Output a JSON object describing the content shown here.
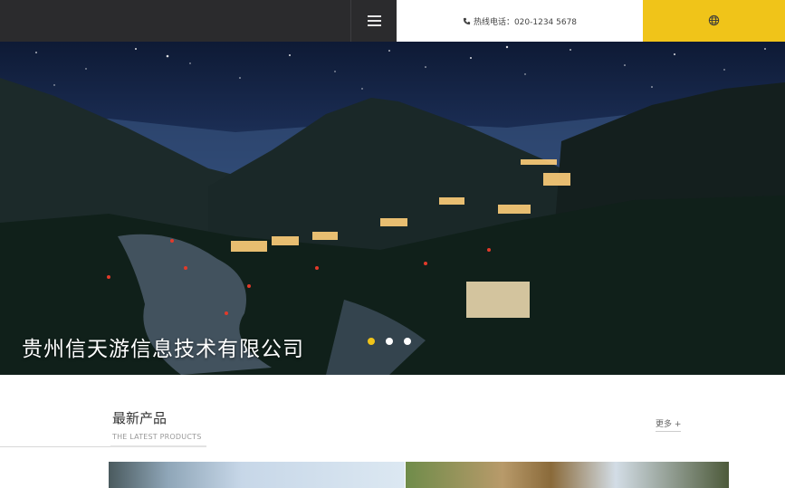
{
  "header": {
    "menu_icon": "hamburger-menu-icon",
    "phone_icon": "phone-icon",
    "phone_text": "热线电话：020-1234 5678",
    "globe_icon": "globe-icon",
    "accent_color": "#f0c419",
    "dark_color": "#2b2b2d"
  },
  "banner": {
    "title": "贵州信天游信息技术有限公司",
    "slides_total": 3,
    "active_slide": 1
  },
  "products": {
    "title": "最新产品",
    "subtitle": "THE LATEST PRODUCTS",
    "more_label": "更多 +"
  }
}
